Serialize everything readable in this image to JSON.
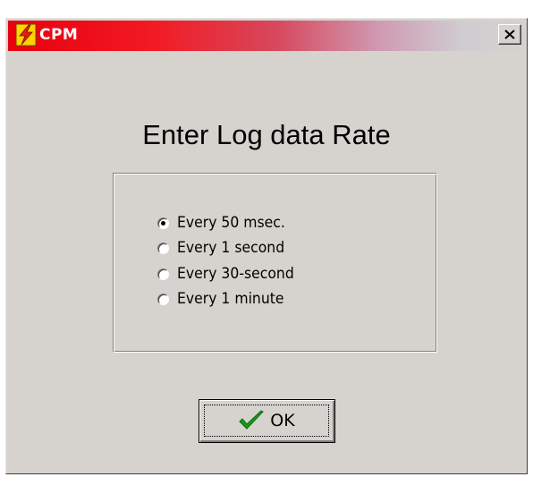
{
  "window": {
    "title": "CPM",
    "icon": "lightning-bolt-icon",
    "close_icon": "close-icon"
  },
  "dialog": {
    "heading": "Enter Log data Rate",
    "options": [
      {
        "label": "Every 50 msec.",
        "selected": true
      },
      {
        "label": "Every 1 second",
        "selected": false
      },
      {
        "label": "Every 30-second",
        "selected": false
      },
      {
        "label": "Every 1 minute",
        "selected": false
      }
    ],
    "ok_button": {
      "label": "OK",
      "icon": "checkmark-icon"
    }
  },
  "colors": {
    "titlebar_start": "#e8000e",
    "titlebar_end": "#d4d2cf",
    "dialog_background": "#d6d3ce",
    "checkmark": "#1a9a1a"
  }
}
